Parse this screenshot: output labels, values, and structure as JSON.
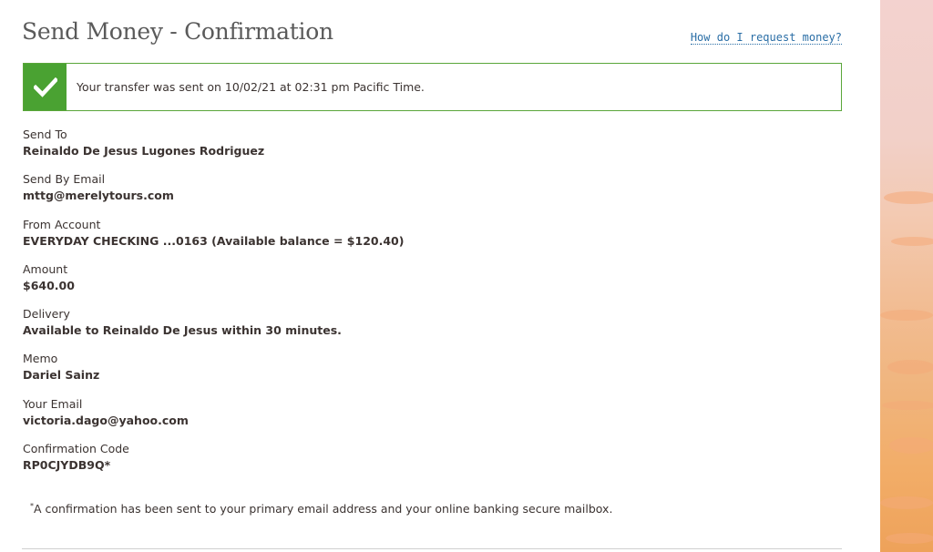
{
  "header": {
    "title": "Send Money - Confirmation",
    "help_link": "How do I request money?"
  },
  "alert": {
    "icon": "checkmark-icon",
    "message": "Your transfer was sent on 10/02/21 at 02:31 pm Pacific Time.",
    "color": "#4aa232"
  },
  "details": [
    {
      "label": "Send To",
      "value": "Reinaldo De Jesus Lugones Rodriguez"
    },
    {
      "label": "Send By Email",
      "value": "mttg@merelytours.com"
    },
    {
      "label": "From Account",
      "value": "EVERYDAY CHECKING ...0163 (Available balance = $120.40)"
    },
    {
      "label": "Amount",
      "value": "$640.00"
    },
    {
      "label": "Delivery",
      "value": "Available to Reinaldo De Jesus within 30 minutes."
    },
    {
      "label": "Memo",
      "value": "Dariel Sainz"
    },
    {
      "label": "Your Email",
      "value": "victoria.dago@yahoo.com"
    },
    {
      "label": "Confirmation Code",
      "value": "RP0CJYDB9Q*"
    }
  ],
  "footnote": {
    "marker": "*",
    "text": "A confirmation has been sent to your primary email address and your online banking secure mailbox."
  }
}
